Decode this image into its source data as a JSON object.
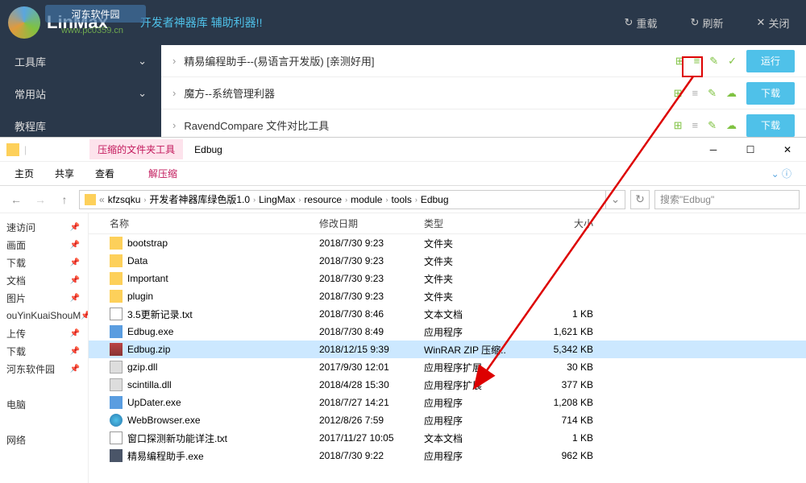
{
  "linmax": {
    "brand": "LinMax",
    "site": "www.pc0359.cn",
    "watermark": "河东软件园",
    "subtitle": "开发者神器库 辅助利器!!",
    "actions": {
      "reload": "重载",
      "refresh": "刷新",
      "close": "关闭"
    },
    "sidebar": [
      {
        "label": "工具库"
      },
      {
        "label": "常用站"
      },
      {
        "label": "教程库"
      }
    ],
    "rows": [
      {
        "title": "精易编程助手--(易语言开发版) [亲测好用]",
        "btn": "运行"
      },
      {
        "title": "魔方--系统管理利器",
        "btn": "下载"
      },
      {
        "title": "RavendCompare  文件对比工具",
        "btn": "下载"
      }
    ]
  },
  "explorer": {
    "compressed_tools": "压缩的文件夹工具",
    "extract": "解压缩",
    "title": "Edbug",
    "ribbon": {
      "home": "主页",
      "share": "共享",
      "view": "查看"
    },
    "breadcrumbs": [
      "kfzsqku",
      "开发者神器库绿色版1.0",
      "LingMax",
      "resource",
      "module",
      "tools",
      "Edbug"
    ],
    "search_placeholder": "搜索\"Edbug\"",
    "side": [
      "速访问",
      "画面",
      "下载",
      "文档",
      "图片",
      "ouYinKuaiShouM",
      "上传",
      "下载",
      "河东软件园",
      "",
      "电脑",
      "",
      "网络"
    ],
    "cols": {
      "name": "名称",
      "date": "修改日期",
      "type": "类型",
      "size": "大小"
    },
    "files": [
      {
        "icon": "folder",
        "name": "bootstrap",
        "date": "2018/7/30 9:23",
        "type": "文件夹",
        "size": ""
      },
      {
        "icon": "folder",
        "name": "Data",
        "date": "2018/7/30 9:23",
        "type": "文件夹",
        "size": ""
      },
      {
        "icon": "folder",
        "name": "Important",
        "date": "2018/7/30 9:23",
        "type": "文件夹",
        "size": ""
      },
      {
        "icon": "folder",
        "name": "plugin",
        "date": "2018/7/30 9:23",
        "type": "文件夹",
        "size": ""
      },
      {
        "icon": "txt",
        "name": "3.5更新记录.txt",
        "date": "2018/7/30 8:46",
        "type": "文本文档",
        "size": "1 KB"
      },
      {
        "icon": "exe",
        "name": "Edbug.exe",
        "date": "2018/7/30 8:49",
        "type": "应用程序",
        "size": "1,621 KB"
      },
      {
        "icon": "zip",
        "name": "Edbug.zip",
        "date": "2018/12/15 9:39",
        "type": "WinRAR ZIP 压缩..",
        "size": "5,342 KB",
        "selected": true
      },
      {
        "icon": "dll",
        "name": "gzip.dll",
        "date": "2017/9/30 12:01",
        "type": "应用程序扩展",
        "size": "30 KB"
      },
      {
        "icon": "dll",
        "name": "scintilla.dll",
        "date": "2018/4/28 15:30",
        "type": "应用程序扩展",
        "size": "377 KB"
      },
      {
        "icon": "exe",
        "name": "UpDater.exe",
        "date": "2018/7/27 14:21",
        "type": "应用程序",
        "size": "1,208 KB"
      },
      {
        "icon": "ie",
        "name": "WebBrowser.exe",
        "date": "2012/8/26 7:59",
        "type": "应用程序",
        "size": "714 KB"
      },
      {
        "icon": "txt",
        "name": "窗口探测新功能详注.txt",
        "date": "2017/11/27 10:05",
        "type": "文本文档",
        "size": "1 KB"
      },
      {
        "icon": "f",
        "name": "精易编程助手.exe",
        "date": "2018/7/30 9:22",
        "type": "应用程序",
        "size": "962 KB"
      }
    ]
  }
}
